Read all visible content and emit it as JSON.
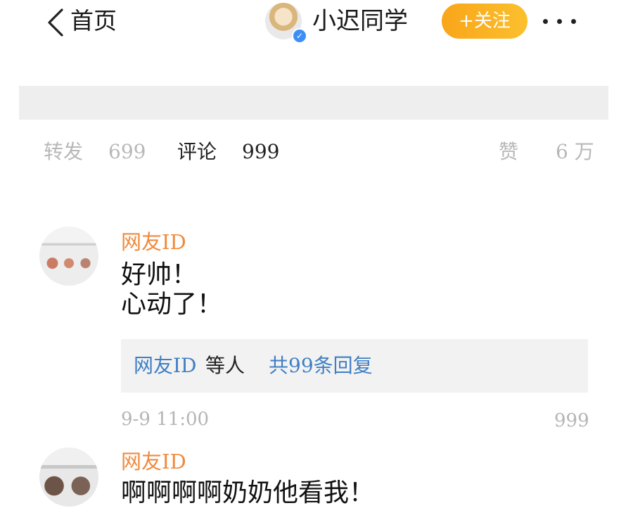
{
  "header": {
    "back_label": "首页",
    "nickname": "小迟同学",
    "follow_label": "+关注",
    "verified_mark": "✓"
  },
  "stats": {
    "repost_label": "转发",
    "repost_count": "699",
    "comment_label": "评论",
    "comment_count": "999",
    "like_label": "赞",
    "like_count": "6 万"
  },
  "comments": [
    {
      "user": "网友ID",
      "text": "好帅！\n心动了！",
      "reply_user": "网友ID",
      "reply_suffix": "等人",
      "reply_link": "共99条回复",
      "time": "9-9 11:00",
      "likes": "999"
    },
    {
      "user": "网友ID",
      "text": "啊啊啊啊奶奶他看我！"
    }
  ],
  "colors": {
    "accent_orange": "#f08a3c",
    "follow_button": "#f9a51a",
    "link_blue": "#3f7fc4",
    "verify_blue": "#3d8ff5"
  }
}
